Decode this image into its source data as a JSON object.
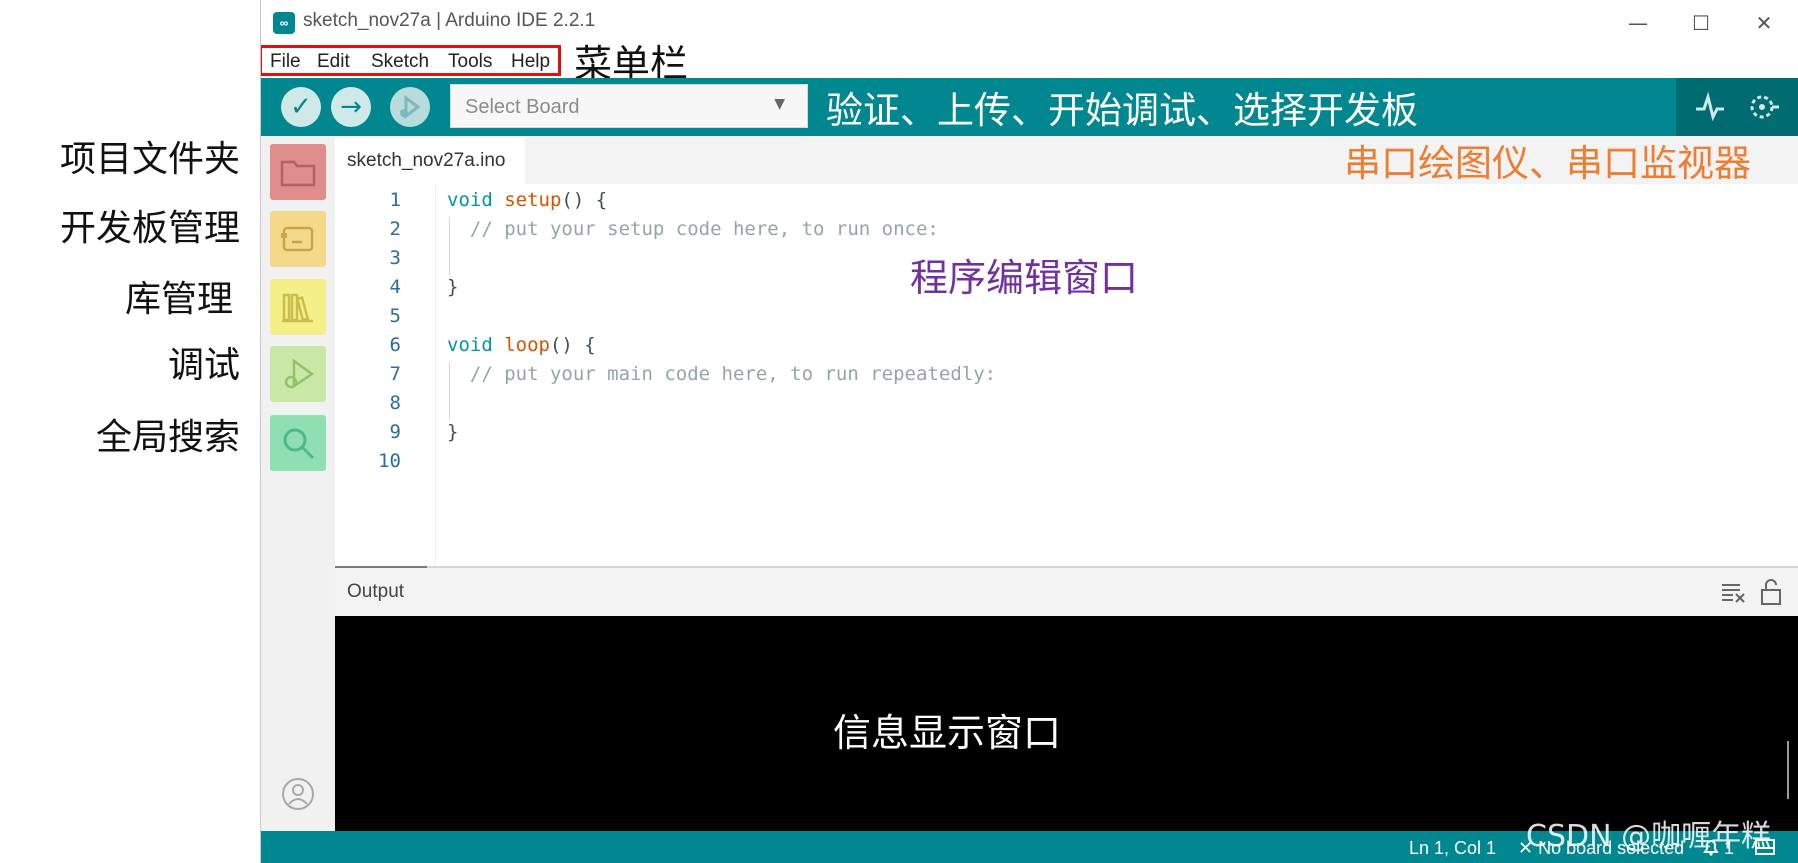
{
  "window": {
    "title": "sketch_nov27a | Arduino IDE 2.2.1",
    "controls": {
      "minimize": "—",
      "maximize": "☐",
      "close": "✕"
    }
  },
  "menu": {
    "items": [
      "File",
      "Edit",
      "Sketch",
      "Tools",
      "Help"
    ]
  },
  "toolbar": {
    "board_select": "Select Board"
  },
  "editor": {
    "tab": "sketch_nov27a.ino",
    "line_numbers": [
      "1",
      "2",
      "3",
      "4",
      "5",
      "6",
      "7",
      "8",
      "9",
      "10"
    ],
    "code": {
      "l1_kw": "void",
      "l1_fn": "setup",
      "l1_rest": "() {",
      "l2": "  // put your setup code here, to run once:",
      "l4": "}",
      "l6_kw": "void",
      "l6_fn": "loop",
      "l6_rest": "() {",
      "l7": "  // put your main code here, to run repeatedly:",
      "l9": "}"
    }
  },
  "output": {
    "title": "Output"
  },
  "status": {
    "position": "Ln 1, Col 1",
    "board": "✕ No board selected",
    "notifications": "1",
    "watermark": "CSDN @咖喱年糕"
  },
  "annotations": {
    "menubar": "菜单栏",
    "toolbar": "验证、上传、开始调试、选择开发板",
    "serial": "串口绘图仪、串口监视器",
    "sketchbook": "项目文件夹",
    "boards": "开发板管理",
    "library": "库管理",
    "debug": "调试",
    "search": "全局搜索",
    "editor": "程序编辑窗口",
    "output": "信息显示窗口"
  },
  "colors": {
    "teal": "#00878f",
    "teal_dark": "#006b70",
    "highlight_red": "#e01010",
    "annotation_orange": "#ed7d31",
    "annotation_purple": "#7030a0",
    "sidebar_folder": "#e08d8d",
    "sidebar_boards": "#f5d98a",
    "sidebar_library": "#f5ef8a",
    "sidebar_debug": "#c9e8a8",
    "sidebar_search": "#8ee0b2"
  },
  "icons": [
    "verify-icon",
    "upload-icon",
    "debug-icon",
    "serial-plotter-icon",
    "serial-monitor-icon",
    "folder-icon",
    "board-icon",
    "library-icon",
    "debug-bug-icon",
    "search-icon",
    "account-icon",
    "clear-output-icon",
    "lock-icon",
    "bell-icon",
    "panel-icon"
  ]
}
